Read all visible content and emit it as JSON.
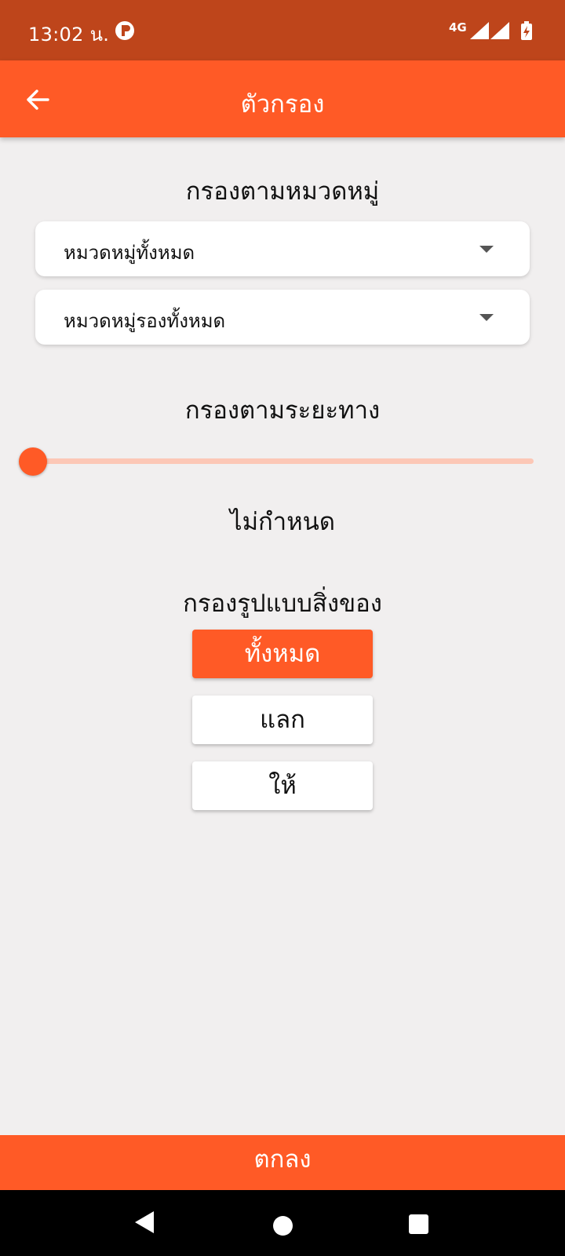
{
  "status_bar": {
    "time": "13:02 น.",
    "network": "4G",
    "icons": [
      "app-notification-icon",
      "signal-icon",
      "signal-icon",
      "battery-charging-icon"
    ]
  },
  "app_bar": {
    "title": "ตัวกรอง",
    "back_icon": "arrow-left-icon"
  },
  "category_filter": {
    "title": "กรองตามหมวดหมู่",
    "main_category": "หมวดหมู่ทั้งหมด",
    "sub_category": "หมวดหมู่รองทั้งหมด"
  },
  "distance_filter": {
    "title": "กรองตามระยะทาง",
    "value": 0,
    "value_label": "ไม่กำหนด"
  },
  "type_filter": {
    "title": "กรองรูปแบบสิ่งของ",
    "options": [
      {
        "label": "ทั้งหมด",
        "selected": true
      },
      {
        "label": "แลก",
        "selected": false
      },
      {
        "label": "ให้",
        "selected": false
      }
    ]
  },
  "confirm_label": "ตกลง",
  "colors": {
    "accent": "#ff5a26",
    "status_bar": "#be451b",
    "background": "#f1efef",
    "slider_track": "#fcc7b6"
  },
  "nav_bar": {
    "icons": [
      "nav-back-icon",
      "nav-home-icon",
      "nav-recents-icon"
    ]
  }
}
